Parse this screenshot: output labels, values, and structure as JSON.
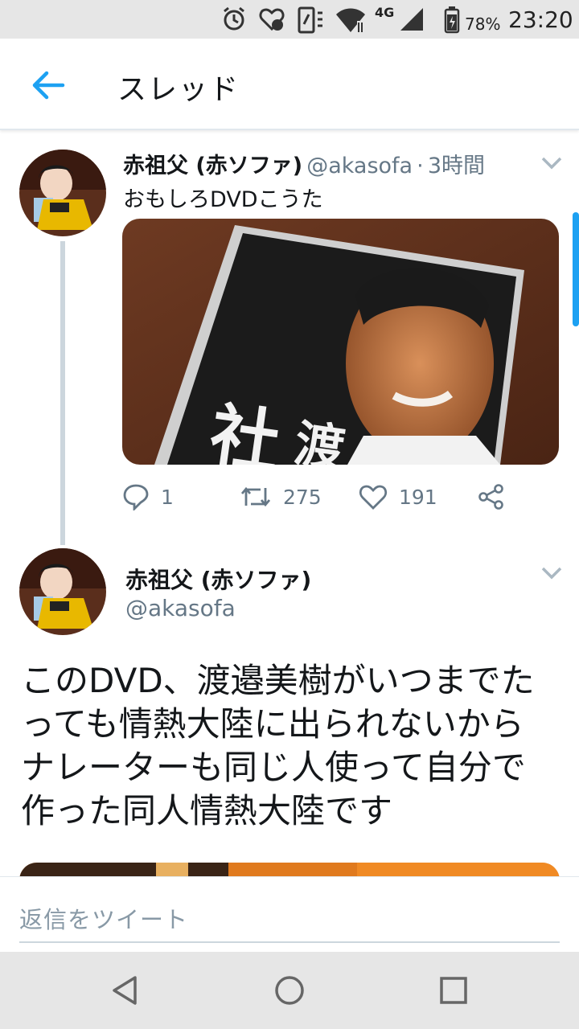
{
  "status_bar": {
    "battery_percent": "78%",
    "time": "23:20",
    "network": "4G",
    "icons": [
      "alarm-icon",
      "heart-sync-icon",
      "vibrate-icon",
      "wifi-icon",
      "signal-icon",
      "battery-charging-icon"
    ]
  },
  "header": {
    "title": "スレッド",
    "back_icon": "arrow-left-icon"
  },
  "tweet1": {
    "display_name": "赤祖父 (赤ソファ)",
    "handle": "@akasofa",
    "separator": "·",
    "time": "3時間",
    "text": "おもしろDVDこうた",
    "actions": {
      "reply_count": "1",
      "retweet_count": "275",
      "like_count": "191"
    }
  },
  "tweet2": {
    "display_name": "赤祖父 (赤ソファ)",
    "handle": "@akasofa",
    "text_lines": [
      "このDVD、渡邉美樹がいつまでた",
      "っても情熱大陸に出られないから",
      "ナレーターも同じ人使って自分で",
      "作った同人情熱大陸です"
    ]
  },
  "reply_box": {
    "placeholder": "返信をツイート"
  },
  "nav_bar": {
    "icons": [
      "back-triangle-icon",
      "home-circle-icon",
      "recents-square-icon"
    ]
  },
  "colors": {
    "accent": "#1da1f2",
    "secondary_text": "#657786",
    "thread_line": "#ccd6dd"
  }
}
